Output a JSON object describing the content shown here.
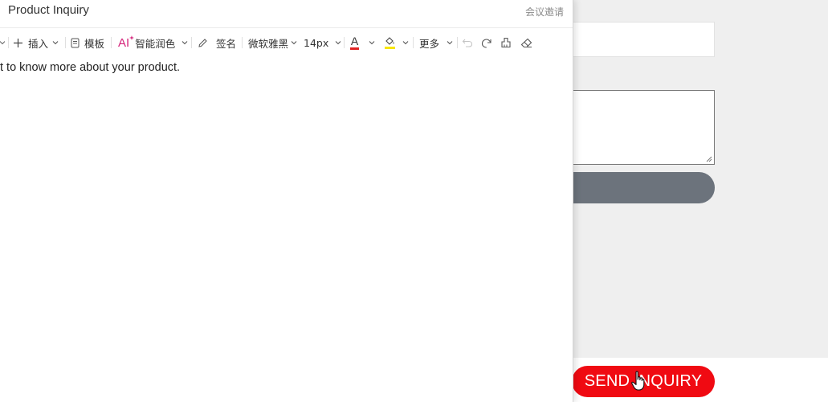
{
  "editor": {
    "title": "Product Inquiry",
    "meeting_invite": "会议邀请",
    "content_text": "t to know more about your product."
  },
  "toolbar": {
    "insert": "插入",
    "template": "模板",
    "ai_badge": "AI",
    "ai_polish": "智能润色",
    "signature": "签名",
    "font_family": "微软雅黑",
    "font_size": "14px",
    "font_color_glyph": "A",
    "more": "更多"
  },
  "background_page": {
    "send_button_label": "SEND INQUIRY"
  },
  "colors": {
    "send_button": "#f00a12",
    "gray_bar": "#6c737c",
    "font_color_underline": "#e02424",
    "highlight_underline": "#f7e600",
    "ai_accent": "#d4237a"
  }
}
